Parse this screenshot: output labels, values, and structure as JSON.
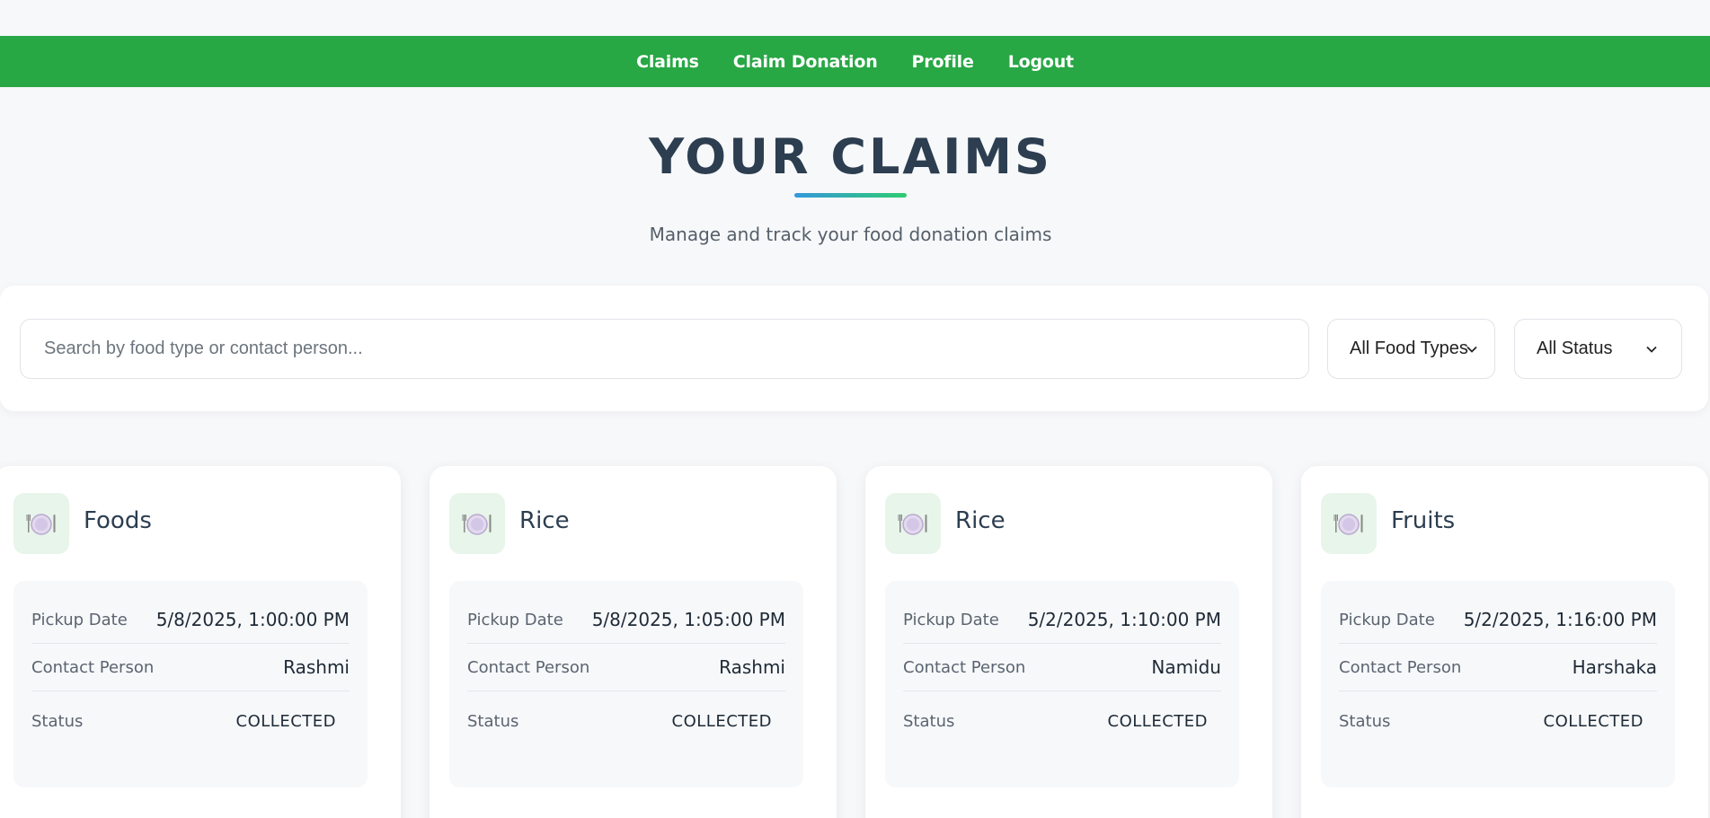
{
  "nav": {
    "items": [
      "Claims",
      "Claim Donation",
      "Profile",
      "Logout"
    ],
    "background": "#28a745"
  },
  "header": {
    "title": "YOUR CLAIMS",
    "subtitle": "Manage and track your food donation claims"
  },
  "filters": {
    "search_placeholder": "Search by food type or contact person...",
    "food_type_selected": "All Food Types",
    "status_selected": "All Status"
  },
  "labels": {
    "pickup_date": "Pickup Date",
    "contact_person": "Contact Person",
    "status": "Status"
  },
  "claims": [
    {
      "icon": "plate-utensils-icon",
      "food_type": "Foods",
      "pickup_date": "5/8/2025, 1:00:00 PM",
      "contact_person": "Rashmi",
      "status": "COLLECTED"
    },
    {
      "icon": "plate-utensils-icon",
      "food_type": "Rice",
      "pickup_date": "5/8/2025, 1:05:00 PM",
      "contact_person": "Rashmi",
      "status": "COLLECTED"
    },
    {
      "icon": "plate-utensils-icon",
      "food_type": "Rice",
      "pickup_date": "5/2/2025, 1:10:00 PM",
      "contact_person": "Namidu",
      "status": "COLLECTED"
    },
    {
      "icon": "plate-utensils-icon",
      "food_type": "Fruits",
      "pickup_date": "5/2/2025, 1:16:00 PM",
      "contact_person": "Harshaka",
      "status": "COLLECTED"
    }
  ]
}
